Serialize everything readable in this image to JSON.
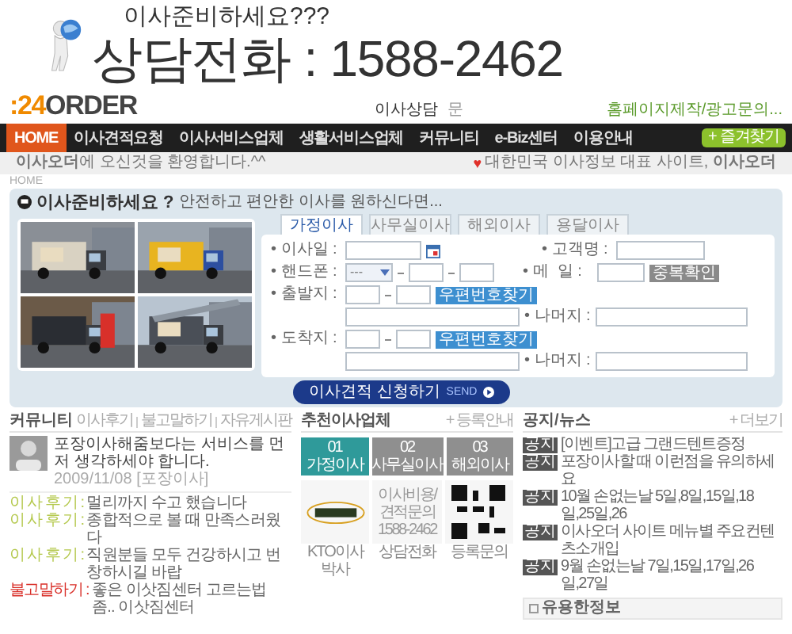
{
  "ad": {
    "subtitle": "이사준비하세요???",
    "phone_line": "상담전화 : 1588-2462"
  },
  "header": {
    "logo": {
      "accent": ":24",
      "rest": "ORDER"
    },
    "center_text": "이사상담",
    "center_extra": "문",
    "top_link": "홈페이지제작/광고문의..."
  },
  "nav": {
    "items": [
      {
        "label": "HOME",
        "selected": true
      },
      {
        "label": "이사견적요청",
        "selected": false
      },
      {
        "label": "이사서비스업체",
        "selected": false
      },
      {
        "label": "생활서비스업체",
        "selected": false
      },
      {
        "label": "커뮤니티",
        "selected": false
      },
      {
        "label": "e-Biz센터",
        "selected": false
      },
      {
        "label": "이용안내",
        "selected": false
      }
    ],
    "favorite": "+ 즐겨찾기"
  },
  "welcome": {
    "message": "**이사오더**에 오신것을 환영합니다.^^",
    "heart": "♥",
    "slogan": "대한민국 이사정보 대표 사이트, **이사오더**"
  },
  "breadcrumb": "HOME",
  "quote_form": {
    "title": "이사준비하세요 ?",
    "subtitle": "안전하고 편안한 이사를 원하신다면...",
    "tabs": [
      {
        "label": "가정이사",
        "selected": true
      },
      {
        "label": "사무실이사",
        "selected": false
      },
      {
        "label": "해외이사",
        "selected": false
      },
      {
        "label": "용달이사",
        "selected": false
      }
    ],
    "move_date": {
      "label": "• 이사일 :"
    },
    "customer_name": {
      "label": "• 고객명 :"
    },
    "phone": {
      "label": "• 핸드폰 :",
      "select": "---"
    },
    "email": {
      "label": "• 메  일 :",
      "button": "중복확인"
    },
    "origin": {
      "label": "• 출발지 :",
      "zip_button": "우편번호찾기",
      "rest_label": "• 나머지 :"
    },
    "destination": {
      "label": "• 도착지 :",
      "zip_button": "우편번호찾기",
      "rest_label": "• 나머지 :"
    },
    "submit": "이사견적 신청하기",
    "submit_tag": "SEND"
  },
  "community": {
    "title": "커뮤니티",
    "links": [
      "이사후기",
      "불고말하기",
      "자유게시판"
    ],
    "featured": {
      "text": "포장이사해줌보다는 서비스를 먼저 생각하세야 합니다.",
      "date": "2009/11/08 [포장이사]"
    },
    "posts": [
      {
        "category": "이 사 후 기 :",
        "title": "멀리까지 수고 했습니다",
        "color": "#b5c94f"
      },
      {
        "category": "이 사 후 기 :",
        "title": "종합적으로 볼 때 만족스러웠다",
        "color": "#b5c94f"
      },
      {
        "category": "이 사 후 기 :",
        "title": "직원분들 모두 건강하시고 번창하시길 바랍",
        "color": "#b5c94f"
      },
      {
        "category": "불고말하기 :",
        "title": "좋은 이삿짐센터 고르는법 좀.. 이삿짐센터",
        "color": "#d9302a"
      }
    ]
  },
  "recommend": {
    "title": "추천이사업체",
    "more": "+ 등록안내",
    "tabs": [
      {
        "label": "01 가정이사",
        "selected": true
      },
      {
        "label": "02 사무실이사",
        "selected": false
      },
      {
        "label": "03 해외이사",
        "selected": false
      }
    ],
    "cards": [
      {
        "kind": "logo",
        "caption": "KTO이사박사"
      },
      {
        "kind": "phone",
        "lines": [
          "이사비용/견적문의",
          "1588-2462"
        ],
        "caption": "상담전화"
      },
      {
        "kind": "qr",
        "caption": "등록문의"
      }
    ]
  },
  "notices": {
    "title": "공지/뉴스",
    "more": "+ 더보기",
    "items": [
      {
        "badge": "공지",
        "text": "[이벤트]고급 그랜드텐트증정"
      },
      {
        "badge": "공지",
        "text": "포장이사할 때 이런점을 유의하세요"
      },
      {
        "badge": "공지",
        "text": "10월 손없는날 5일,8일,15일,18일,25일,26"
      },
      {
        "badge": "공지",
        "text": "이사오더 사이트 메뉴별 주요컨텐츠소개입"
      },
      {
        "badge": "공지",
        "text": "9월 손없는날 7일,15일,17일,26일,27일"
      }
    ],
    "info_title": "유용한정보"
  }
}
